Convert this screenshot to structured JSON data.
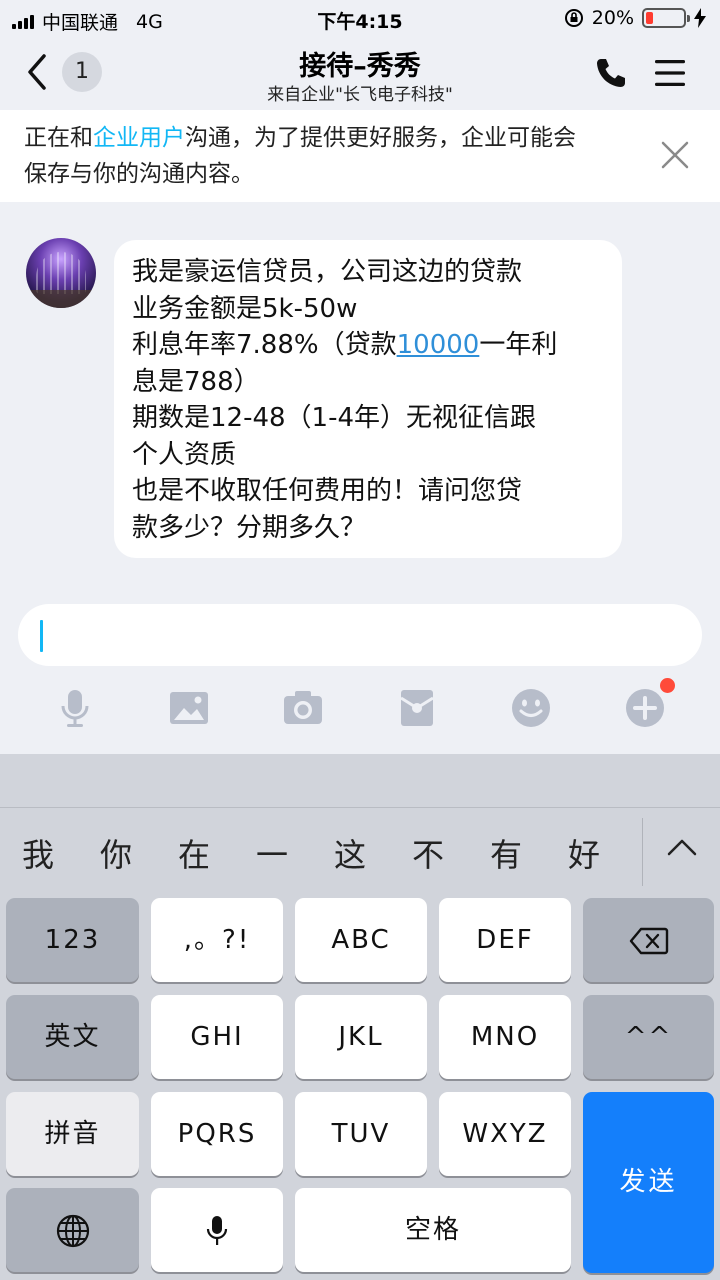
{
  "status_bar": {
    "carrier": "中国联通",
    "network": "4G",
    "time": "下午4:15",
    "battery_percent": "20%",
    "battery_level": 0.2
  },
  "header": {
    "back_count": "1",
    "title": "接待–秀秀",
    "subtitle": "来自企业\"长飞电子科技\"",
    "icons": [
      "chevron-left-icon",
      "phone-icon",
      "menu-icon"
    ]
  },
  "notice": {
    "prefix": "正在和",
    "highlight": "企业用户",
    "line1_rest": "沟通，为了提供更好服务，企业可能会",
    "line2": "保存与你的沟通内容。",
    "highlight_color": "#12b7f5"
  },
  "message": {
    "lines": [
      "我是豪运信贷员，公司这边的贷款",
      "业务金额是5k-50w"
    ],
    "line3_a": "利息年率7.88%（贷款",
    "line3_link": "10000",
    "line3_b": "一年利",
    "lines_after": [
      "息是788）",
      "期数是12-48（1-4年）无视征信跟",
      "个人资质",
      "也是不收取任何费用的！请问您贷",
      "款多少？分期多久？"
    ]
  },
  "input": {
    "value": "",
    "toolbar_icons": [
      "microphone-icon",
      "image-icon",
      "camera-icon",
      "red-packet-icon",
      "emoji-icon",
      "plus-icon"
    ]
  },
  "keyboard": {
    "candidates": [
      "我",
      "你",
      "在",
      "一",
      "这",
      "不",
      "有",
      "好"
    ],
    "keys": {
      "num": "123",
      "punct": ",。?!",
      "abc": "ABC",
      "def": "DEF",
      "english": "英文",
      "ghi": "GHI",
      "jkl": "JKL",
      "mno": "MNO",
      "emoticon": "^^",
      "pinyin": "拼音",
      "pqrs": "PQRS",
      "tuv": "TUV",
      "wxyz": "WXYZ",
      "send": "发送",
      "space": "空格"
    },
    "send_color": "#147ffb"
  }
}
